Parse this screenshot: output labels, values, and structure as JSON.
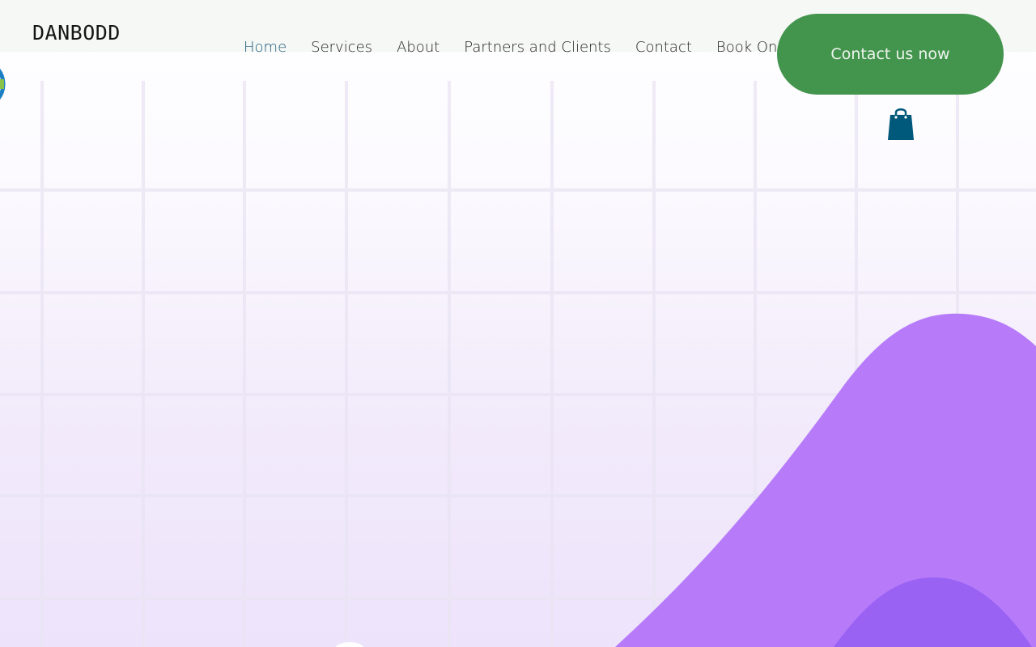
{
  "site": {
    "logo_text": "DANBODD"
  },
  "nav": {
    "items": [
      {
        "label": "Home",
        "active": true
      },
      {
        "label": "Services",
        "active": false
      },
      {
        "label": "About",
        "active": false
      },
      {
        "label": "Partners and Clients",
        "active": false
      },
      {
        "label": "Contact",
        "active": false
      },
      {
        "label": "Book Online",
        "active": false
      }
    ]
  },
  "cta": {
    "label": "Contact us now"
  },
  "icons": {
    "cart": "shopping-bag-icon",
    "badge": "circle-badge-icon"
  },
  "colors": {
    "header_bg": "#f6f8f5",
    "nav_active": "#1b5a7c",
    "cta_bg": "#43944d",
    "cart": "#00587a",
    "wave_light": "#b77bfa",
    "wave_dark": "#9a62f3",
    "badge_ring": "#1c7fc4"
  }
}
